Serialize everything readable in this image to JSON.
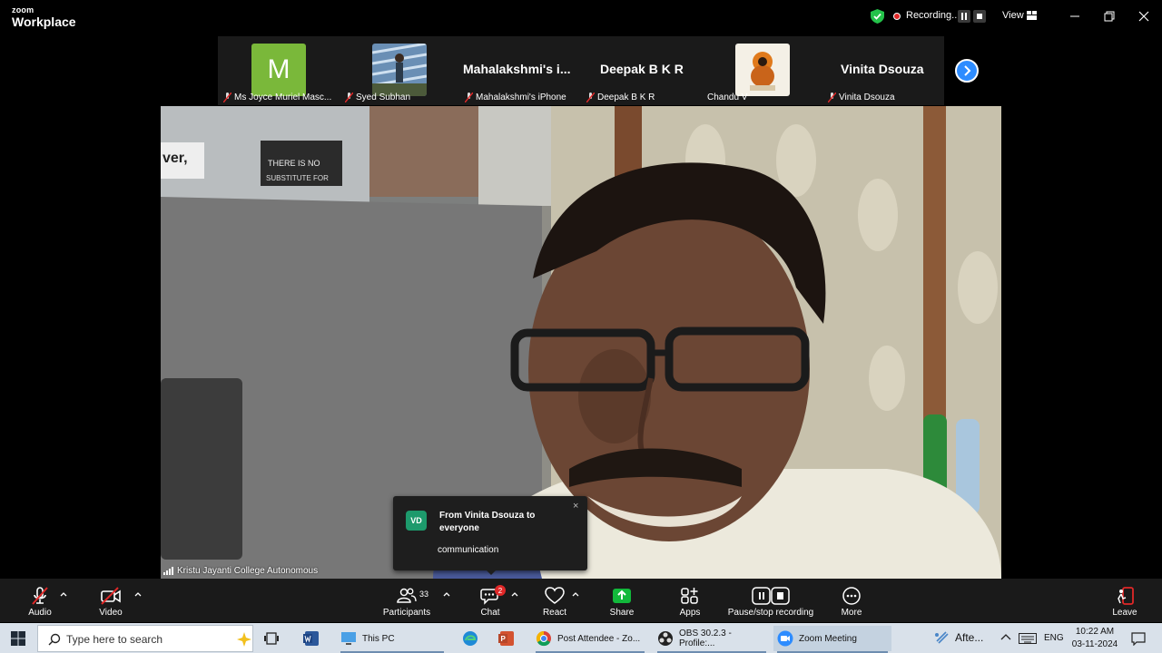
{
  "app": {
    "brand_small": "zoom",
    "brand_big": "Workplace",
    "recording_label": "Recording...",
    "view_label": "View"
  },
  "thumbnails": [
    {
      "name": "Ms Joyce Muriel Masc...",
      "avatar_letter": "M",
      "muted": true
    },
    {
      "name": "Syed Subhan",
      "muted": true
    },
    {
      "name": "Mahalakshmi's iPhone",
      "big_name": "Mahalakshmi's i...",
      "muted": true
    },
    {
      "name": "Deepak B K R",
      "big_name": "Deepak B K R",
      "muted": true
    },
    {
      "name": "Chandu V",
      "muted": false
    },
    {
      "name": "Vinita Dsouza",
      "big_name": "Vinita Dsouza",
      "muted": true
    }
  ],
  "main_video": {
    "participant_name": "Kristu Jayanti College Autonomous",
    "poster_text_1": "ver,",
    "poster_text_2": "THERE IS NO",
    "poster_text_3": "SUBSTITUTE FOR"
  },
  "chat_toast": {
    "initials": "VD",
    "title": "From Vinita Dsouza to everyone",
    "message": "communication",
    "close": "×"
  },
  "toolbar": {
    "audio": "Audio",
    "video": "Video",
    "participants": "Participants",
    "participants_count": "33",
    "chat": "Chat",
    "chat_badge": "2",
    "react": "React",
    "share": "Share",
    "apps": "Apps",
    "recording": "Pause/stop recording",
    "more": "More",
    "leave": "Leave"
  },
  "taskbar": {
    "search_placeholder": "Type here to search",
    "apps": [
      {
        "label": "This PC"
      },
      {
        "label": "Post Attendee - Zo..."
      },
      {
        "label": "OBS 30.2.3 - Profile:..."
      },
      {
        "label": "Zoom Meeting"
      }
    ],
    "weather": "Afte...",
    "lang": "ENG",
    "time": "10:22 AM",
    "date": "03-11-2024"
  },
  "colors": {
    "accent_blue": "#2d8cff",
    "avatar_green": "#7ab83a",
    "share_green": "#12b83b",
    "record_red": "#e02828",
    "leave_red": "#e02828"
  }
}
